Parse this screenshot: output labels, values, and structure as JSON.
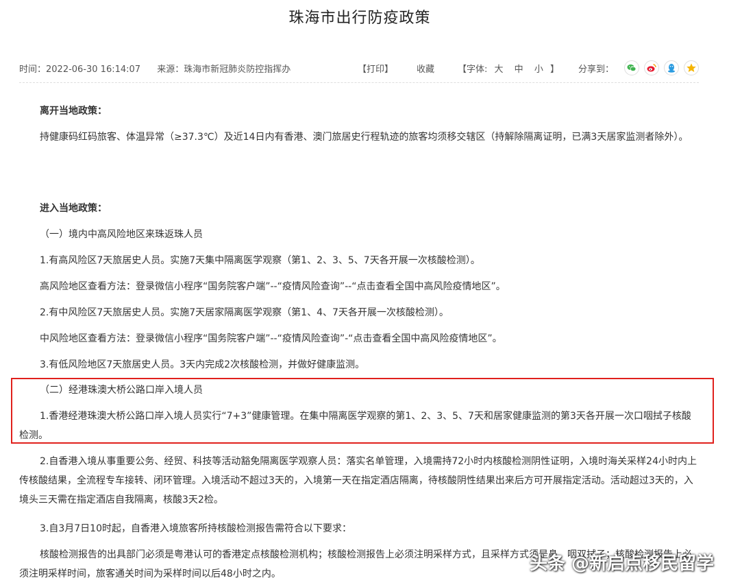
{
  "article": {
    "title": "珠海市出行防疫政策",
    "time": "时间：2022-06-30 16:14:07",
    "source": "来源：珠海市新冠肺炎防控指挥办"
  },
  "toolbar": {
    "print": "【打印】",
    "favorite": "收藏",
    "font_label": "【字体:",
    "font_large": "大",
    "font_medium": "中",
    "font_small": "小",
    "font_close": "】",
    "share_label": "分享到："
  },
  "share_icons": [
    {
      "name": "wechat-icon",
      "color": "#3fb34f"
    },
    {
      "name": "weibo-icon",
      "color": "#e6162d"
    },
    {
      "name": "qq-icon",
      "color": "#2a9be0"
    },
    {
      "name": "qzone-icon",
      "color": "#f5b400"
    }
  ],
  "body": {
    "leave_heading": "离开当地政策：",
    "leave_text": "持健康码红码旅客、体温异常（≥37.3℃）及近14日内有香港、澳门旅居史行程轨迹的旅客均须移交辖区（持解除隔离证明，已满3天居家监测者除外）。",
    "enter_heading": "进入当地政策：",
    "section1_title": "（一）境内中高风险地区来珠返珠人员",
    "item1": "1.有高风险区7天旅居史人员。实施7天集中隔离医学观察（第1、2、3、5、7天各开展一次核酸检测）。",
    "item1_check": "高风险地区查看方法：登录微信小程序“国务院客户端”--“疫情风险查询”--“点击查看全国中高风险疫情地区”。",
    "item2": "2.有中风险区7天旅居史人员。实施7天居家隔离医学观察（第1、4、7天各开展一次核酸检测）。",
    "item2_check": "中风险地区查看方法：登录微信小程序“国务院客户端”--“疫情风险查询”-“点击查看全国中高风险疫情地区”。",
    "item3": "3.有低风险地区7天旅居史人员。3天内完成2次核酸检测，并做好健康监测。",
    "section2_title": "（二）经港珠澳大桥公路口岸入境人员",
    "s2_item1": "1.香港经港珠澳大桥公路口岸入境人员实行“7+3”健康管理。在集中隔离医学观察的第1、2、3、5、7天和居家健康监测的第3天各开展一次口咽拭子核酸检测。",
    "s2_item2": "2.自香港入境从事重要公务、经贸、科技等活动豁免隔离医学观察人员：落实名单管理，入境需持72小时内核酸检测阴性证明，入境时海关采样24小时内上传核酸结果，全流程专车接转、闭环管理。入境活动不超过3天的，入境第一天在指定酒店隔离，待核酸阴性结果出来后方可开展指定活动。活动超过3天的，入境头三天需在指定酒店自我隔离，核酸3天2检。",
    "s2_item3": "3.自3月7日10时起，自香港入境旅客所持核酸检测报告需符合以下要求：",
    "s2_item3_detail": "核酸检测报告的出具部门必须是粤港认可的香港定点核酸检测机构；核酸检测报告上必须注明采样方式，且采样方式须是鼻、咽双拭子；核酸检测报告上必须注明采样时间，旅客通关时间为采样时间以后48小时之内。"
  },
  "highlight_color": "#e0201c",
  "watermark": "头条 @新启点移民留学"
}
